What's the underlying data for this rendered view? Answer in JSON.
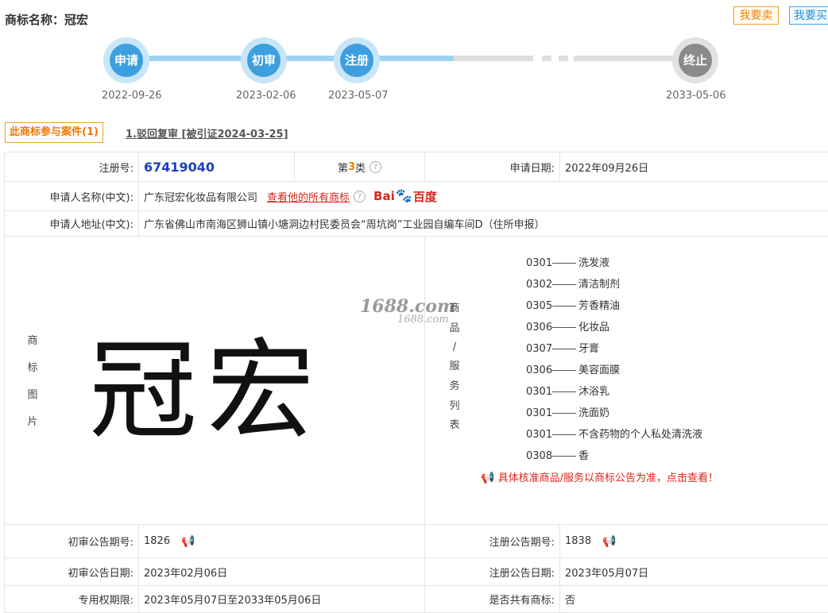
{
  "header": {
    "title": "商标名称：冠宏",
    "sell_label": "我要卖",
    "buy_label": "我要买"
  },
  "timeline": {
    "nodes": [
      {
        "label": "申请",
        "date": "2022-09-26"
      },
      {
        "label": "初审",
        "date": "2023-02-06"
      },
      {
        "label": "注册",
        "date": "2023-05-07"
      },
      {
        "label": "终止",
        "date": "2033-05-06"
      }
    ]
  },
  "cases": {
    "tag": "此商标参与案件(1)",
    "link": "1.驳回复审 [被引证2024-03-25]"
  },
  "info": {
    "reg_no_label": "注册号:",
    "reg_no": "67419040",
    "class_prefix": "第",
    "class_num": "3",
    "class_suffix": "类",
    "help_glyph": "?",
    "apply_date_label": "申请日期:",
    "apply_date": "2022年09月26日",
    "applicant_label": "申请人名称(中文):",
    "applicant": "广东冠宏化妆品有限公司",
    "view_all_link": "查看他的所有商标",
    "baidu_pre": "Bai",
    "baidu_post": "百度",
    "address_label": "申请人地址(中文):",
    "address": "广东省佛山市南海区狮山镇小塘洞边村民委员会“周坑岗”工业园自编车间D（住所申报）",
    "image_label_chars": [
      "商",
      "标",
      "图",
      "片"
    ],
    "trademark_text": "冠宏",
    "watermark": "1688.com",
    "watermark_small": "1688.com",
    "goods_label_chars": [
      "商",
      "品",
      "/",
      "服",
      "务",
      "列",
      "表"
    ],
    "goods": [
      {
        "code": "0301",
        "name": "洗发液"
      },
      {
        "code": "0302",
        "name": "清洁制剂"
      },
      {
        "code": "0305",
        "name": "芳香精油"
      },
      {
        "code": "0306",
        "name": "化妆品"
      },
      {
        "code": "0307",
        "name": "牙膏"
      },
      {
        "code": "0306",
        "name": "美容面膜"
      },
      {
        "code": "0301",
        "name": "沐浴乳"
      },
      {
        "code": "0301",
        "name": "洗面奶"
      },
      {
        "code": "0301",
        "name": "不含药物的个人私处清洗液"
      },
      {
        "code": "0308",
        "name": "香"
      }
    ],
    "goods_notice": "具体核准商品/服务以商标公告为准，点击查看！",
    "prelim_no_label": "初审公告期号:",
    "prelim_no": "1826",
    "reg_pub_no_label": "注册公告期号:",
    "reg_pub_no": "1838",
    "prelim_date_label": "初审公告日期:",
    "prelim_date": "2023年02月06日",
    "reg_pub_date_label": "注册公告日期:",
    "reg_pub_date": "2023年05月07日",
    "term_label": "专用权期限:",
    "term": "2023年05月07日至2033年05月06日",
    "shared_label": "是否共有商标:",
    "shared": "否"
  },
  "colors": {
    "accent_blue": "#3d9fdf",
    "orange": "#f08000",
    "red": "#d9261c",
    "regno_blue": "#1e3fbb"
  }
}
